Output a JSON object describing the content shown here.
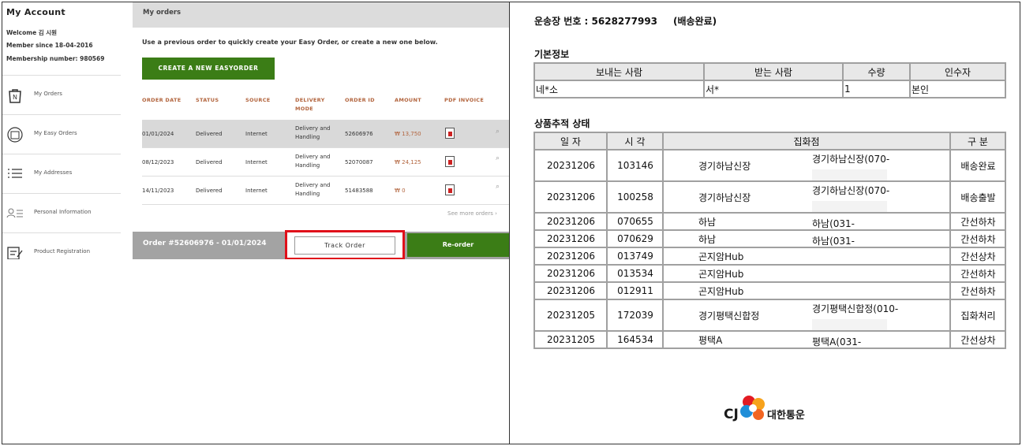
{
  "left": {
    "account_title": "My Account",
    "welcome": "Welcome 김 시원",
    "member_since": "Member since 18-04-2016",
    "membership": "Membership number: 980569",
    "sidebar": [
      {
        "label": "My Orders",
        "icon": "orders-bag-icon"
      },
      {
        "label": "My Easy Orders",
        "icon": "easy-orders-icon"
      },
      {
        "label": "My Addresses",
        "icon": "address-list-icon"
      },
      {
        "label": "Personal Information",
        "icon": "person-card-icon"
      },
      {
        "label": "Product Registration",
        "icon": "register-pen-icon"
      }
    ],
    "header": "My orders",
    "intro": "Use a previous order to quickly create your Easy Order, or create a new one below.",
    "create_button": "CREATE A NEW EASYORDER",
    "columns": [
      "ORDER DATE",
      "STATUS",
      "SOURCE",
      "DELIVERY MODE",
      "ORDER ID",
      "AMOUNT",
      "PDF INVOICE"
    ],
    "orders": [
      {
        "date": "01/01/2024",
        "status": "Delivered",
        "source": "Internet",
        "mode": "Delivery and Handling",
        "id": "52606976",
        "amount": "₩ 13,750"
      },
      {
        "date": "08/12/2023",
        "status": "Delivered",
        "source": "Internet",
        "mode": "Delivery and Handling",
        "id": "52070087",
        "amount": "₩ 24,125"
      },
      {
        "date": "14/11/2023",
        "status": "Delivered",
        "source": "Internet",
        "mode": "Delivery and Handling",
        "id": "51483588",
        "amount": "₩ 0"
      }
    ],
    "see_more": "See more orders ›",
    "order_bar": "Order #52606976 - 01/01/2024",
    "track_button": "Track Order",
    "reorder_button": "Re-order",
    "accent_green": "#3b7d16",
    "highlight_red": "#e0101a"
  },
  "right": {
    "waybill": "운송장 번호 : 5628277993",
    "waybill_status": "(배송완료)",
    "basic_info_title": "기본정보",
    "basic_headers": [
      "보내는 사람",
      "받는 사람",
      "수량",
      "인수자"
    ],
    "basic_row": [
      "네*소",
      "서*",
      "1",
      "본인"
    ],
    "tracking_title": "상품추적 상태",
    "tracking_headers": [
      "일 자",
      "시 각",
      "집화점",
      "구 분"
    ],
    "tracking_rows": [
      {
        "date": "20231206",
        "time": "103146",
        "loc": "경기하남신장",
        "branch": "경기하남신장(070-",
        "type": "배송완료"
      },
      {
        "date": "20231206",
        "time": "100258",
        "loc": "경기하남신장",
        "branch": "경기하남신장(070-",
        "type": "배송출발"
      },
      {
        "date": "20231206",
        "time": "070655",
        "loc": "하남",
        "branch": "하남(031-",
        "type": "간선하차"
      },
      {
        "date": "20231206",
        "time": "070629",
        "loc": "하남",
        "branch": "하남(031-",
        "type": "간선하차"
      },
      {
        "date": "20231206",
        "time": "013749",
        "loc": "곤지암Hub",
        "branch": "",
        "type": "간선상차"
      },
      {
        "date": "20231206",
        "time": "013534",
        "loc": "곤지암Hub",
        "branch": "",
        "type": "간선하차"
      },
      {
        "date": "20231206",
        "time": "012911",
        "loc": "곤지암Hub",
        "branch": "",
        "type": "간선하차"
      },
      {
        "date": "20231205",
        "time": "172039",
        "loc": "경기평택신합정",
        "branch": "경기평택신합정(010-",
        "type": "집화처리"
      },
      {
        "date": "20231205",
        "time": "164534",
        "loc": "평택A",
        "branch": "평택A(031-",
        "type": "간선상차"
      }
    ],
    "logo_text": "대한통운",
    "logo_mark": "CJ"
  }
}
